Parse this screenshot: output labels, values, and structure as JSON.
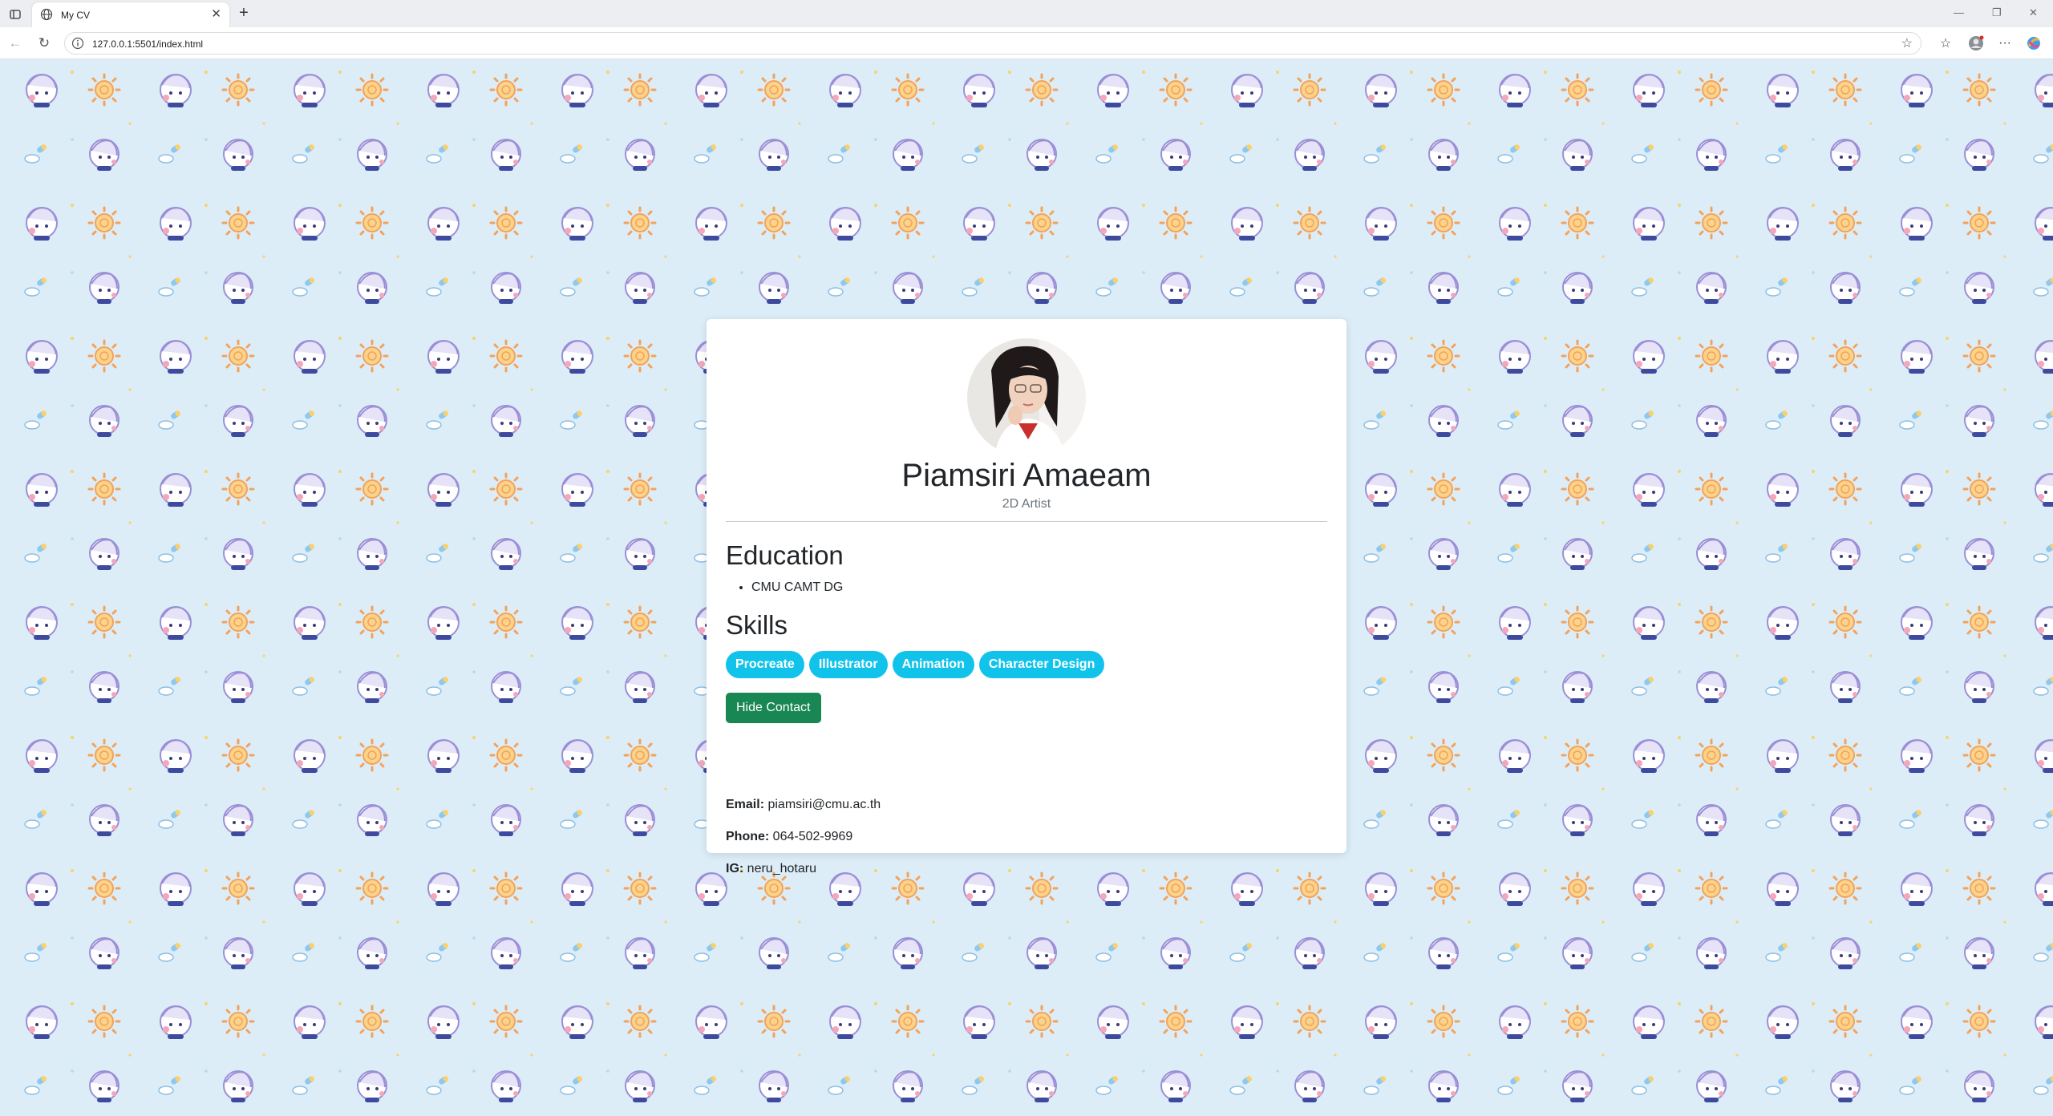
{
  "browser": {
    "tab_title": "My CV",
    "url": "127.0.0.1:5501/index.html"
  },
  "profile": {
    "name": "Piamsiri Amaeam",
    "role": "2D Artist"
  },
  "education": {
    "heading": "Education",
    "items": [
      "CMU CAMT DG"
    ]
  },
  "skills": {
    "heading": "Skills",
    "items": [
      "Procreate",
      "Illustrator",
      "Animation",
      "Character Design"
    ]
  },
  "contact": {
    "toggle_label": "Hide Contact",
    "email_label": "Email:",
    "email": "piamsiri@cmu.ac.th",
    "phone_label": "Phone:",
    "phone": "064-502-9969",
    "ig_label": "IG:",
    "ig": "neru_hotaru"
  },
  "colors": {
    "badge": "#11c3ea",
    "button": "#198754",
    "background": "#dcedf8"
  }
}
